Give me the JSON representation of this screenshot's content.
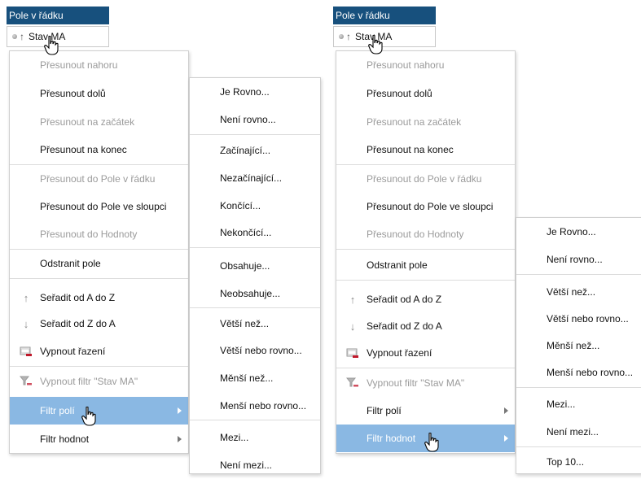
{
  "panels": [
    {
      "header": "Pole v řádku",
      "chip": {
        "label": "Stav MA",
        "icon": "sort-up-icon"
      },
      "menu": {
        "items": [
          {
            "label": "Přesunout nahoru",
            "disabled": true
          },
          {
            "label": "Přesunout dolů",
            "disabled": false
          },
          {
            "label": "Přesunout na začátek",
            "disabled": true
          },
          {
            "label": "Přesunout na konec",
            "disabled": false
          },
          {
            "label": "Přesunout do Pole v řádku",
            "disabled": true
          },
          {
            "label": "Přesunout do Pole ve sloupci",
            "disabled": false
          },
          {
            "label": "Přesunout do Hodnoty",
            "disabled": true
          },
          {
            "label": "Odstranit pole",
            "disabled": false
          },
          {
            "label": "Seřadit od A do Z",
            "icon": "sort-up-icon"
          },
          {
            "label": "Seřadit od Z do A",
            "icon": "sort-down-icon"
          },
          {
            "label": "Vypnout řazení",
            "icon": "clear-sort-icon"
          },
          {
            "label": "Vypnout filtr \"Stav MA\"",
            "icon": "clear-filter-icon",
            "disabled": true
          },
          {
            "label": "Filtr polí",
            "submenu": true,
            "highlighted": true
          },
          {
            "label": "Filtr hodnot",
            "submenu": true
          }
        ]
      },
      "submenu": {
        "items": [
          "Je Rovno...",
          "Není rovno...",
          "Začínající...",
          "Nezačínající...",
          "Končící...",
          "Nekončící...",
          "Obsahuje...",
          "Neobsahuje...",
          "Větší než...",
          "Větší nebo rovno...",
          "Měnší než...",
          "Menší nebo rovno...",
          "Mezi...",
          "Není mezi..."
        ]
      }
    },
    {
      "header": "Pole v řádku",
      "chip": {
        "label": "Stav MA",
        "icon": "sort-up-icon"
      },
      "menu": {
        "items": [
          {
            "label": "Přesunout nahoru",
            "disabled": true
          },
          {
            "label": "Přesunout dolů",
            "disabled": false
          },
          {
            "label": "Přesunout na začátek",
            "disabled": true
          },
          {
            "label": "Přesunout na konec",
            "disabled": false
          },
          {
            "label": "Přesunout do Pole v řádku",
            "disabled": true
          },
          {
            "label": "Přesunout do Pole ve sloupci",
            "disabled": false
          },
          {
            "label": "Přesunout do Hodnoty",
            "disabled": true
          },
          {
            "label": "Odstranit pole",
            "disabled": false
          },
          {
            "label": "Seřadit od A do Z",
            "icon": "sort-up-icon"
          },
          {
            "label": "Seřadit od Z do A",
            "icon": "sort-down-icon"
          },
          {
            "label": "Vypnout řazení",
            "icon": "clear-sort-icon"
          },
          {
            "label": "Vypnout filtr \"Stav MA\"",
            "icon": "clear-filter-icon",
            "disabled": true
          },
          {
            "label": "Filtr polí",
            "submenu": true
          },
          {
            "label": "Filtr hodnot",
            "submenu": true,
            "highlighted": true
          }
        ]
      },
      "submenu": {
        "items": [
          "Je Rovno...",
          "Není rovno...",
          "Větší než...",
          "Větší nebo rovno...",
          "Měnší než...",
          "Menší nebo rovno...",
          "Mezi...",
          "Není mezi...",
          "Top 10..."
        ]
      }
    }
  ],
  "colors": {
    "header_bg": "#17507d",
    "highlight_bg": "#8ab8e3",
    "disabled_text": "#9a9a9a"
  }
}
